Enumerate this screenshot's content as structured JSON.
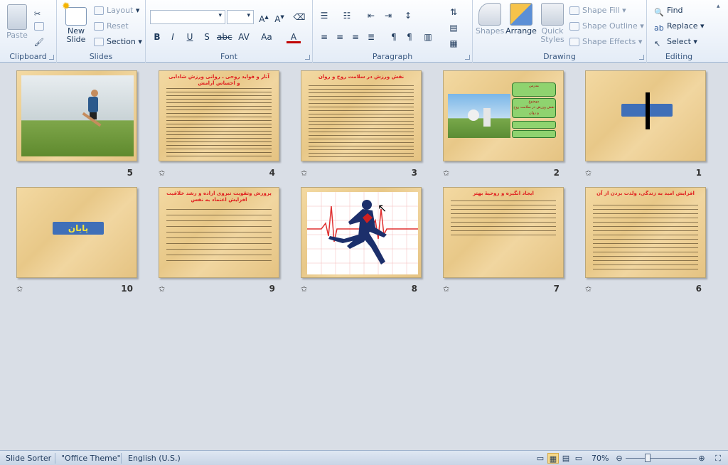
{
  "ribbon": {
    "clipboard": {
      "label": "Clipboard",
      "paste": "Paste"
    },
    "slides": {
      "label": "Slides",
      "new_slide": "New Slide",
      "layout": "Layout",
      "reset": "Reset",
      "section": "Section"
    },
    "font": {
      "label": "Font",
      "font_name": "",
      "font_size": ""
    },
    "paragraph": {
      "label": "Paragraph"
    },
    "drawing": {
      "label": "Drawing",
      "shapes": "Shapes",
      "arrange": "Arrange",
      "quick_styles": "Quick Styles",
      "shape_fill": "Shape Fill",
      "shape_outline": "Shape Outline",
      "shape_effects": "Shape Effects"
    },
    "editing": {
      "label": "Editing",
      "find": "Find",
      "replace": "Replace",
      "select": "Select"
    }
  },
  "slides": [
    {
      "num": "1",
      "title": ""
    },
    {
      "num": "2",
      "title": "",
      "box1": "مدرس",
      "box2": "موضوع",
      "box3": "نقش ورزش در سلامت روح و روان"
    },
    {
      "num": "3",
      "title": "نقش ورزش در سلامت روح و روان"
    },
    {
      "num": "4",
      "title": "آثار و فواید روحی ـ روانی ورزش شادابی و احساس آرامش"
    },
    {
      "num": "5",
      "title": ""
    },
    {
      "num": "6",
      "title": "افزایش امید به زندگی، ولذت بردن از آن"
    },
    {
      "num": "7",
      "title": "ایجاد انگیزه و روحیۀ بهتر"
    },
    {
      "num": "8",
      "title": ""
    },
    {
      "num": "9",
      "title": "پرورش وتقویت نیروی اراده و رشد خلاقیت افزایش اعتماد به نفس"
    },
    {
      "num": "10",
      "title": "",
      "end_label": "پایان"
    }
  ],
  "status": {
    "view": "Slide Sorter",
    "theme": "\"Office Theme\"",
    "language": "English (U.S.)",
    "zoom": "70%"
  }
}
